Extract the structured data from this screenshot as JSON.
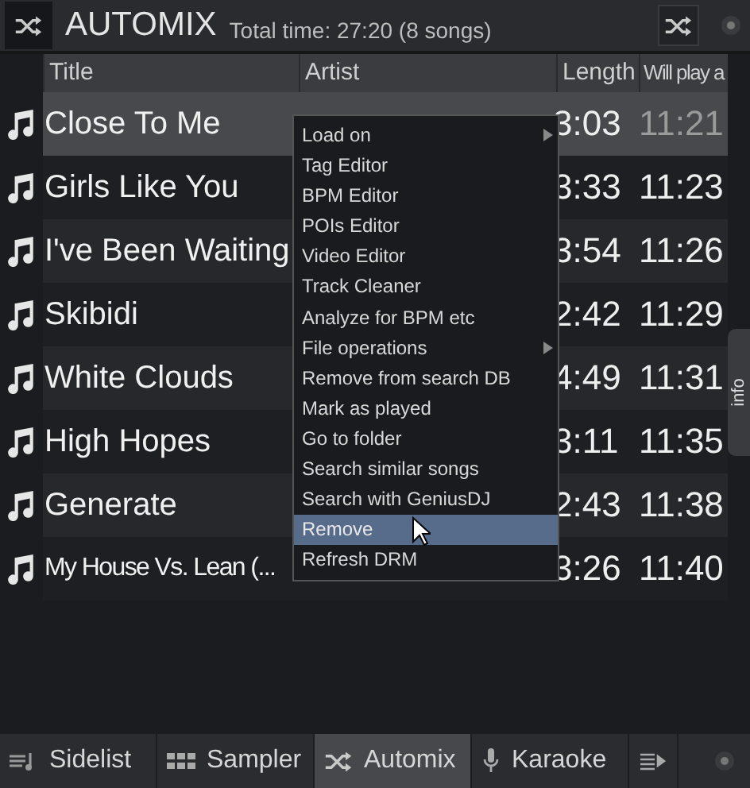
{
  "header": {
    "title": "AUTOMIX",
    "summary": "Total time: 27:20 (8 songs)"
  },
  "table": {
    "columns": [
      "Title",
      "Artist",
      "Length",
      "Will play a"
    ],
    "rows": [
      {
        "title": "Close To Me",
        "length": "3:03",
        "will_play_at": "11:21",
        "selected": true
      },
      {
        "title": "Girls Like You",
        "length": "3:33",
        "will_play_at": "11:23",
        "selected": false
      },
      {
        "title": "I've Been Waiting",
        "length": "3:54",
        "will_play_at": "11:26",
        "selected": false
      },
      {
        "title": "Skibidi",
        "length": "2:42",
        "will_play_at": "11:29",
        "selected": false
      },
      {
        "title": "White Clouds",
        "length": "4:49",
        "will_play_at": "11:31",
        "selected": false
      },
      {
        "title": "High Hopes",
        "length": "3:11",
        "will_play_at": "11:35",
        "selected": false
      },
      {
        "title": "Generate",
        "length": "2:43",
        "will_play_at": "11:38",
        "selected": false
      },
      {
        "title": "My House Vs. Lean (...",
        "length": "3:26",
        "will_play_at": "11:40",
        "selected": false
      }
    ]
  },
  "context_menu": [
    {
      "label": "Load on",
      "submenu": true,
      "selected": false
    },
    {
      "label": "Tag Editor",
      "submenu": false,
      "selected": false
    },
    {
      "label": "BPM Editor",
      "submenu": false,
      "selected": false
    },
    {
      "label": "POIs Editor",
      "submenu": false,
      "selected": false
    },
    {
      "label": "Video Editor",
      "submenu": false,
      "selected": false
    },
    {
      "label": "Track Cleaner",
      "submenu": false,
      "selected": false
    },
    {
      "label": "Analyze for BPM etc",
      "submenu": false,
      "selected": false
    },
    {
      "label": "File operations",
      "submenu": true,
      "selected": false
    },
    {
      "label": "Remove from search DB",
      "submenu": false,
      "selected": false
    },
    {
      "label": "Mark as played",
      "submenu": false,
      "selected": false
    },
    {
      "label": "Go to folder",
      "submenu": false,
      "selected": false
    },
    {
      "label": "Search similar songs",
      "submenu": false,
      "selected": false
    },
    {
      "label": "Search with GeniusDJ",
      "submenu": false,
      "selected": false
    },
    {
      "label": "Remove",
      "submenu": false,
      "selected": true
    },
    {
      "label": "Refresh DRM",
      "submenu": false,
      "selected": false
    }
  ],
  "side_tab": {
    "label": "info"
  },
  "bottom_tabs": [
    {
      "label": "Sidelist",
      "kind": "sidelist",
      "selected": false
    },
    {
      "label": "Sampler",
      "kind": "sampler",
      "selected": false
    },
    {
      "label": "Automix",
      "kind": "automix",
      "selected": true
    },
    {
      "label": "Karaoke",
      "kind": "karaoke",
      "selected": false
    }
  ]
}
